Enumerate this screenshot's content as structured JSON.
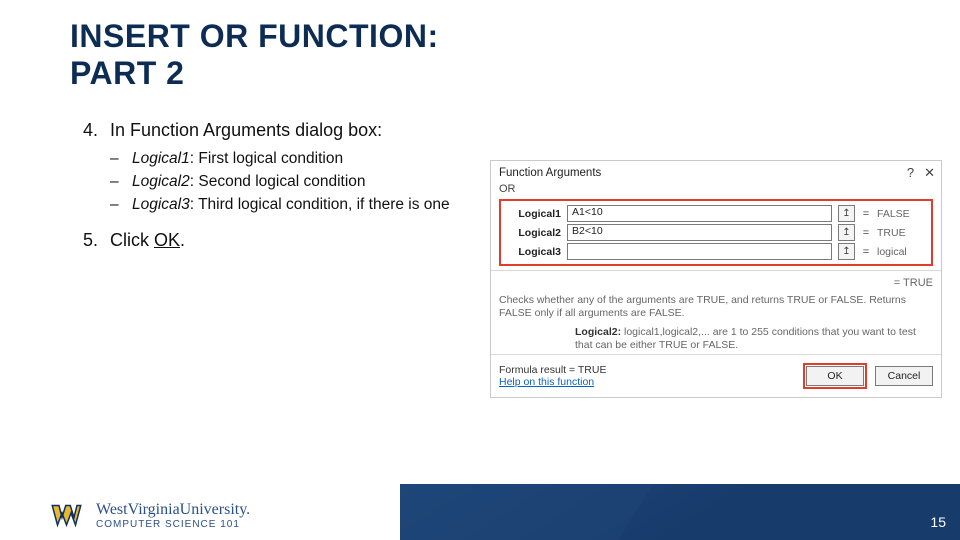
{
  "title_line1": "INSERT OR FUNCTION:",
  "title_line2": "PART 2",
  "step4_num": "4.",
  "step4_text": "In Function Arguments dialog box:",
  "bullets": [
    {
      "dash": "–",
      "em": "Logical1",
      "rest": ": First logical condition"
    },
    {
      "dash": "–",
      "em": "Logical2",
      "rest": ": Second logical condition"
    },
    {
      "dash": "–",
      "em": "Logical3",
      "rest": ": Third logical condition, if there is one"
    }
  ],
  "step5_num": "5.",
  "step5_pre": "Click ",
  "step5_ok": "OK",
  "step5_post": ".",
  "dialog": {
    "title": "Function Arguments",
    "help_glyph": "?",
    "close_glyph": "✕",
    "fn": "OR",
    "rows": [
      {
        "label": "Logical1",
        "value": "A1<10",
        "eq": "=",
        "result": "FALSE"
      },
      {
        "label": "Logical2",
        "value": "B2<10",
        "eq": "=",
        "result": "TRUE"
      },
      {
        "label": "Logical3",
        "value": "",
        "eq": "=",
        "result": "logical"
      }
    ],
    "ref_glyph": "↥",
    "overall_eq": "=  TRUE",
    "desc": "Checks whether any of the arguments are TRUE, and returns TRUE or FALSE. Returns FALSE only if all arguments are FALSE.",
    "argname": "Logical2:",
    "argdesc": "  logical1,logical2,... are 1 to 255 conditions that you want to test that can be either TRUE or FALSE.",
    "formula_result_label": "Formula result =  ",
    "formula_result_value": "TRUE",
    "help_link": "Help on this function",
    "ok": "OK",
    "cancel": "Cancel"
  },
  "brand": {
    "top": "WestVirginiaUniversity.",
    "bottom": "COMPUTER SCIENCE 101"
  },
  "page_number": "15",
  "colors": {
    "heading": "#0d2c54",
    "highlight": "#e33c2a",
    "footer": "#173b6b"
  }
}
